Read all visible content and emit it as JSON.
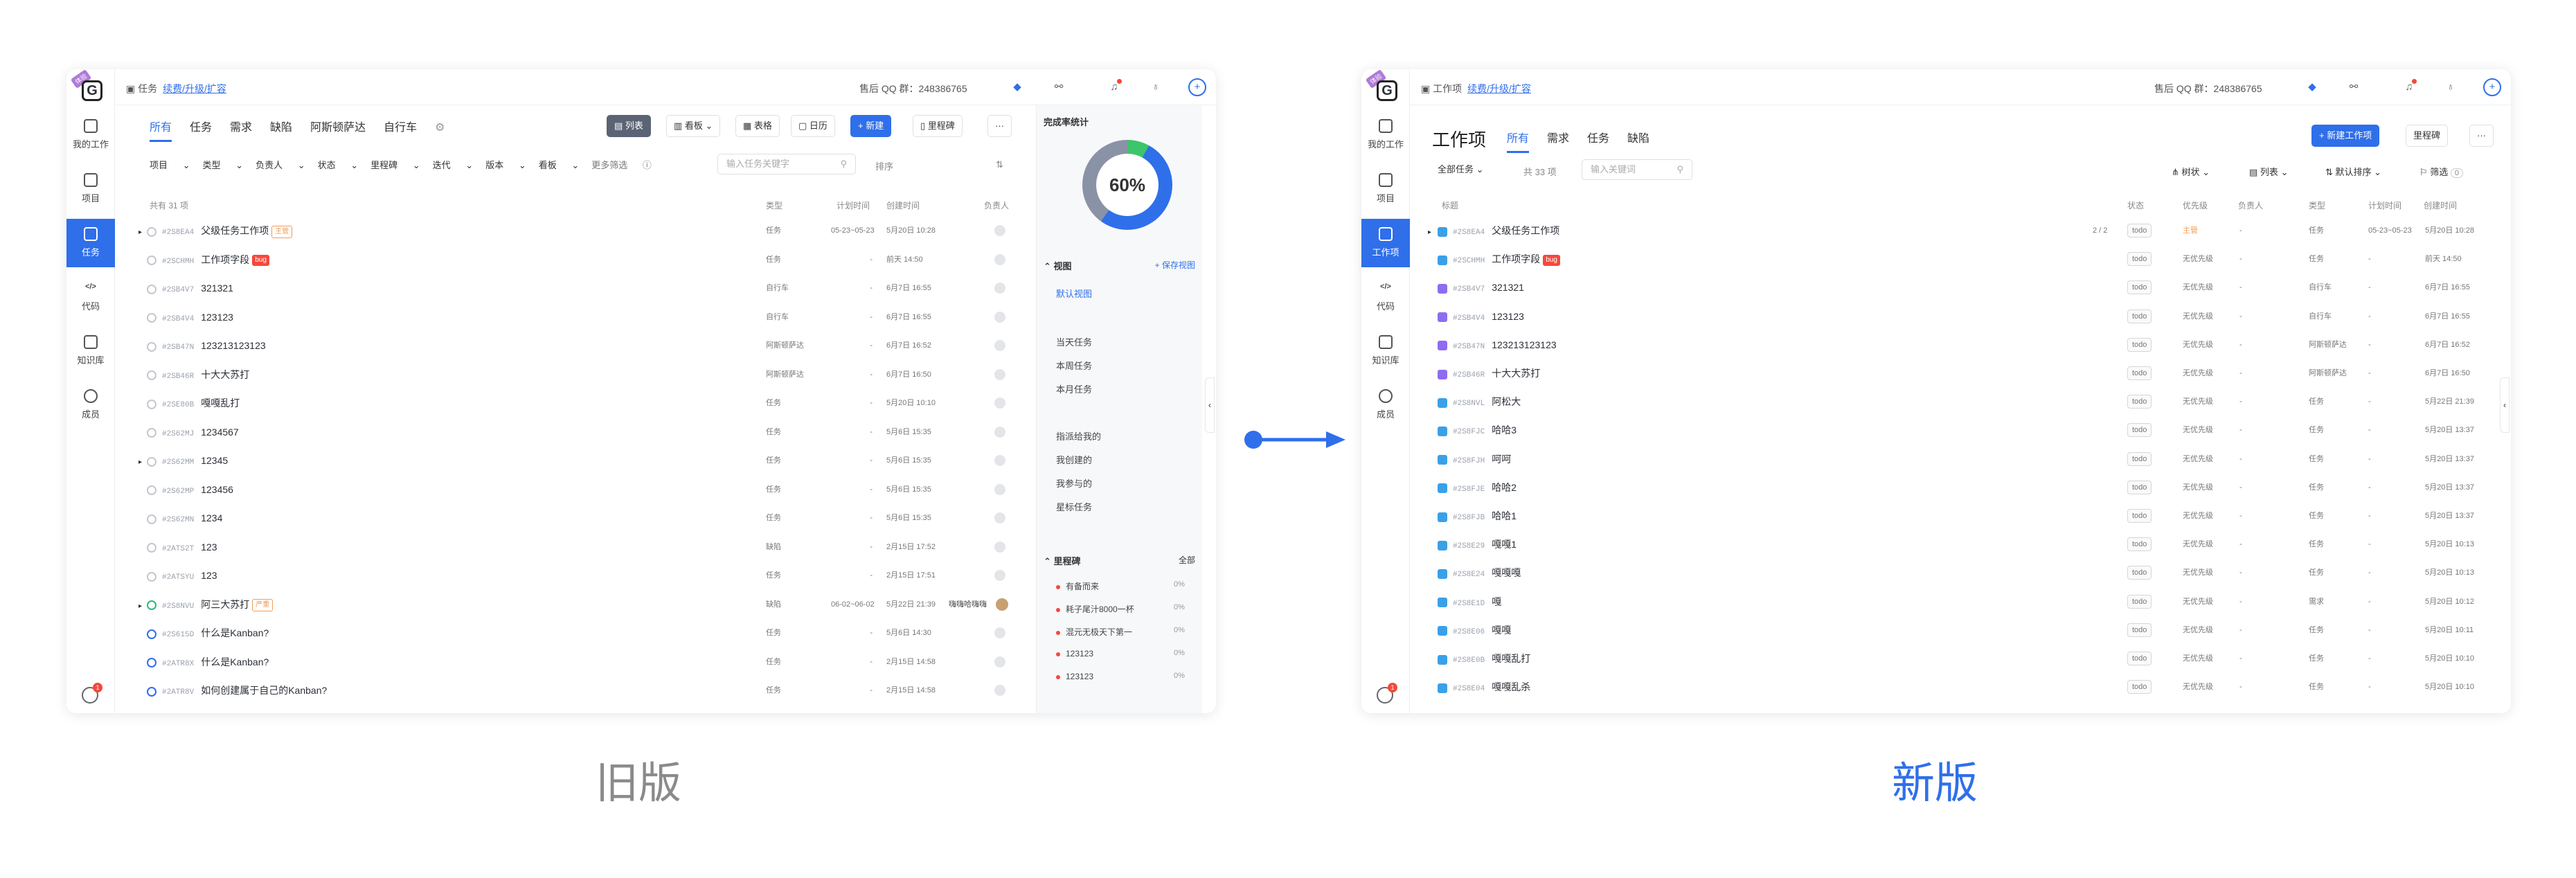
{
  "sidebar": {
    "logo_tag": "体验",
    "items": [
      "我的工作",
      "项目",
      "任务",
      "代码",
      "知识库",
      "成员"
    ],
    "items_new": [
      "我的工作",
      "项目",
      "工作项",
      "代码",
      "知识库",
      "成员"
    ],
    "gear_badge": "1"
  },
  "topbar": {
    "old_crumb": "任务",
    "new_crumb": "工作项",
    "link": "续费/升级/扩容",
    "qq": "售后 QQ 群：248386765"
  },
  "old": {
    "tabs": [
      "所有",
      "任务",
      "需求",
      "缺陷",
      "阿斯顿萨达",
      "自行车"
    ],
    "view_buttons": [
      "列表",
      "看板",
      "表格",
      "日历"
    ],
    "new_button": "+ 新建",
    "milestone_button": "里程碑",
    "filters": [
      "项目",
      "类型",
      "负责人",
      "状态",
      "里程碑",
      "迭代",
      "版本",
      "看板"
    ],
    "more_filter": "更多筛选",
    "search_placeholder": "输入任务关键字",
    "sort": "排序",
    "count": "共有 31 项",
    "headers": [
      "类型",
      "计划时间",
      "创建时间",
      "负责人"
    ],
    "rows": [
      {
        "id": "#2S8EA4",
        "title": "父级任务工作项",
        "badge": "主管",
        "type": "任务",
        "plan": "05-23~05-23",
        "created": "5月20日 10:28"
      },
      {
        "id": "#2SCHMH",
        "title": "工作项字段",
        "badge": "bug",
        "type": "任务",
        "plan": "-",
        "created": "前天 14:50"
      },
      {
        "id": "#2SB4V7",
        "title": "321321",
        "badge": "",
        "type": "自行车",
        "plan": "-",
        "created": "6月7日 16:55"
      },
      {
        "id": "#2SB4V4",
        "title": "123123",
        "badge": "",
        "type": "自行车",
        "plan": "-",
        "created": "6月7日 16:55"
      },
      {
        "id": "#2SB47N",
        "title": "123213123123",
        "badge": "",
        "type": "阿斯顿萨达",
        "plan": "-",
        "created": "6月7日 16:52"
      },
      {
        "id": "#2SB46R",
        "title": "十大大苏打",
        "badge": "",
        "type": "阿斯顿萨达",
        "plan": "-",
        "created": "6月7日 16:50"
      },
      {
        "id": "#2SE80B",
        "title": "嘎嘎乱打",
        "badge": "",
        "type": "任务",
        "plan": "-",
        "created": "5月20日 10:10"
      },
      {
        "id": "#2S62MJ",
        "title": "1234567",
        "badge": "",
        "type": "任务",
        "plan": "-",
        "created": "5月6日 15:35"
      },
      {
        "id": "#2S62MM",
        "title": "12345",
        "badge": "",
        "type": "任务",
        "plan": "-",
        "created": "5月6日 15:35"
      },
      {
        "id": "#2S62MP",
        "title": "123456",
        "badge": "",
        "type": "任务",
        "plan": "-",
        "created": "5月6日 15:35"
      },
      {
        "id": "#2S62MN",
        "title": "1234",
        "badge": "",
        "type": "任务",
        "plan": "-",
        "created": "5月6日 15:35"
      },
      {
        "id": "#2ATS2T",
        "title": "123",
        "badge": "",
        "type": "缺陷",
        "plan": "-",
        "created": "2月15日 17:52"
      },
      {
        "id": "#2ATSYU",
        "title": "123",
        "badge": "",
        "type": "任务",
        "plan": "-",
        "created": "2月15日 17:51"
      },
      {
        "id": "#2S8NVU",
        "title": "阿三大苏打",
        "badge": "严重",
        "type": "缺陷",
        "plan": "06-02~06-02",
        "created": "5月22日 21:39"
      },
      {
        "id": "#2S615D",
        "title": "什么是Kanban?",
        "badge": "",
        "type": "任务",
        "plan": "-",
        "created": "5月6日 14:30"
      },
      {
        "id": "#2ATR8X",
        "title": "什么是Kanban?",
        "badge": "",
        "type": "任务",
        "plan": "-",
        "created": "2月15日 14:58"
      },
      {
        "id": "#2ATR8V",
        "title": "如何创建属于自己的Kanban?",
        "badge": "",
        "type": "任务",
        "plan": "-",
        "created": "2月15日 14:58"
      }
    ],
    "assignee_name": "嗨嗨哈嗨嗨",
    "panel": {
      "stat_title": "完成率统计",
      "percent": "60%",
      "view_title": "视图",
      "save_view": "+ 保存视图",
      "default_view": "默认视图",
      "views1": [
        "当天任务",
        "本周任务",
        "本月任务"
      ],
      "views2": [
        "指派给我的",
        "我创建的",
        "我参与的",
        "星标任务"
      ],
      "ms_title": "里程碑",
      "ms_all": "全部",
      "milestones": [
        "有备而来",
        "耗子尾汁8000一杯",
        "混元无极天下第一",
        "123123",
        "123123"
      ],
      "ms_pct": "0%"
    }
  },
  "new": {
    "title": "工作项",
    "tabs": [
      "所有",
      "需求",
      "任务",
      "缺陷"
    ],
    "new_button": "+ 新建工作项",
    "milestone_button": "里程碑",
    "filter_all": "全部任务",
    "count": "共 33 项",
    "search_placeholder": "输入关键词",
    "toolbar": [
      "树状",
      "列表",
      "默认排序",
      "筛选"
    ],
    "filter_count": "0",
    "headers": [
      "标题",
      "状态",
      "优先级",
      "负责人",
      "类型",
      "计划时间",
      "创建时间"
    ],
    "status": "todo",
    "priority": "无优先级",
    "rows": [
      {
        "id": "#2S8EA4",
        "title": "父级任务工作项",
        "badge": "",
        "prio": "主管",
        "type": "任务",
        "plan": "05-23~05-23",
        "created": "5月20日 10:28",
        "sub": "2 / 2"
      },
      {
        "id": "#2SCHMH",
        "title": "工作项字段",
        "badge": "bug",
        "prio": "",
        "type": "任务",
        "plan": "-",
        "created": "前天 14:50",
        "sub": ""
      },
      {
        "id": "#2SB4V7",
        "title": "321321",
        "badge": "",
        "prio": "",
        "type": "自行车",
        "plan": "-",
        "created": "6月7日 16:55",
        "sub": ""
      },
      {
        "id": "#2SB4V4",
        "title": "123123",
        "badge": "",
        "prio": "",
        "type": "自行车",
        "plan": "-",
        "created": "6月7日 16:55",
        "sub": ""
      },
      {
        "id": "#2SB47N",
        "title": "123213123123",
        "badge": "",
        "prio": "",
        "type": "阿斯顿萨达",
        "plan": "-",
        "created": "6月7日 16:52",
        "sub": ""
      },
      {
        "id": "#2SB46R",
        "title": "十大大苏打",
        "badge": "",
        "prio": "",
        "type": "阿斯顿萨达",
        "plan": "-",
        "created": "6月7日 16:50",
        "sub": ""
      },
      {
        "id": "#2S8NVL",
        "title": "阿松大",
        "badge": "",
        "prio": "",
        "type": "任务",
        "plan": "-",
        "created": "5月22日 21:39",
        "sub": ""
      },
      {
        "id": "#2S8FJC",
        "title": "哈哈3",
        "badge": "",
        "prio": "",
        "type": "任务",
        "plan": "-",
        "created": "5月20日 13:37",
        "sub": ""
      },
      {
        "id": "#2S8FJH",
        "title": "呵呵",
        "badge": "",
        "prio": "",
        "type": "任务",
        "plan": "-",
        "created": "5月20日 13:37",
        "sub": ""
      },
      {
        "id": "#2S8FJE",
        "title": "哈哈2",
        "badge": "",
        "prio": "",
        "type": "任务",
        "plan": "-",
        "created": "5月20日 13:37",
        "sub": ""
      },
      {
        "id": "#2S8FJB",
        "title": "哈哈1",
        "badge": "",
        "prio": "",
        "type": "任务",
        "plan": "-",
        "created": "5月20日 13:37",
        "sub": ""
      },
      {
        "id": "#2S8E29",
        "title": "嘎嘎1",
        "badge": "",
        "prio": "",
        "type": "任务",
        "plan": "-",
        "created": "5月20日 10:13",
        "sub": ""
      },
      {
        "id": "#2S8E24",
        "title": "嘎嘎嘎",
        "badge": "",
        "prio": "",
        "type": "任务",
        "plan": "-",
        "created": "5月20日 10:13",
        "sub": ""
      },
      {
        "id": "#2S8E1D",
        "title": "嘎",
        "badge": "",
        "prio": "",
        "type": "需求",
        "plan": "-",
        "created": "5月20日 10:12",
        "sub": ""
      },
      {
        "id": "#2S8E06",
        "title": "嘎嘎",
        "badge": "",
        "prio": "",
        "type": "任务",
        "plan": "-",
        "created": "5月20日 10:11",
        "sub": ""
      },
      {
        "id": "#2S8E0B",
        "title": "嘎嘎乱打",
        "badge": "",
        "prio": "",
        "type": "任务",
        "plan": "-",
        "created": "5月20日 10:10",
        "sub": ""
      },
      {
        "id": "#2S8E04",
        "title": "嘎嘎乱杀",
        "badge": "",
        "prio": "",
        "type": "任务",
        "plan": "-",
        "created": "5月20日 10:10",
        "sub": ""
      }
    ]
  },
  "captions": {
    "old": "旧版",
    "new": "新版"
  },
  "colors": {
    "primary": "#2f6fea",
    "caption_old": "#8a8a8a",
    "caption_new": "#2f6fea"
  }
}
